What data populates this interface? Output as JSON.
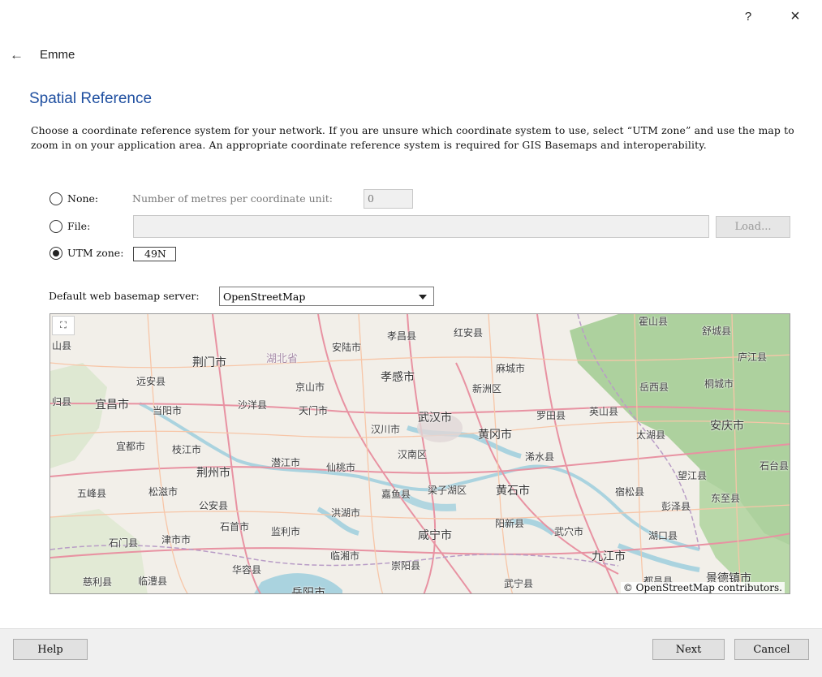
{
  "window": {
    "help_glyph": "?",
    "close_glyph": "×"
  },
  "nav": {
    "back_glyph": "←",
    "title": "Emme"
  },
  "page": {
    "heading": "Spatial Reference",
    "description": "Choose a coordinate reference system for your network. If you are unsure which coordinate system to use, select “UTM zone” and use the map to zoom in on your application area. An appropriate coordinate reference system is required for GIS Basemaps and interoperability."
  },
  "options": {
    "none_label": "None:",
    "none_hint": "Number of metres per coordinate unit:",
    "none_value": "0",
    "file_label": "File:",
    "file_value": "",
    "load_label": "Load...",
    "utm_label": "UTM zone:",
    "utm_value": "49N",
    "selected": "utm"
  },
  "basemap": {
    "label": "Default web basemap server:",
    "selected": "OpenStreetMap"
  },
  "map": {
    "fullscreen_glyph": "⛶",
    "attribution": "© OpenStreetMap contributors.",
    "cities": [
      {
        "name": "山县",
        "cls": "med"
      },
      {
        "name": "荆门市",
        "cls": "big"
      },
      {
        "name": "湖北省",
        "cls": "prov"
      },
      {
        "name": "安陆市",
        "cls": "med"
      },
      {
        "name": "孝昌县",
        "cls": "med"
      },
      {
        "name": "红安县",
        "cls": "med"
      },
      {
        "name": "霍山县",
        "cls": "med"
      },
      {
        "name": "舒城县",
        "cls": "med"
      },
      {
        "name": "庐江县",
        "cls": "med"
      },
      {
        "name": "远安县",
        "cls": "med"
      },
      {
        "name": "京山市",
        "cls": "med"
      },
      {
        "name": "孝感市",
        "cls": "big"
      },
      {
        "name": "麻城市",
        "cls": "med"
      },
      {
        "name": "新洲区",
        "cls": "med"
      },
      {
        "name": "岳西县",
        "cls": "med"
      },
      {
        "name": "桐城市",
        "cls": "med"
      },
      {
        "name": "归县",
        "cls": "med"
      },
      {
        "name": "宜昌市",
        "cls": "big"
      },
      {
        "name": "当阳市",
        "cls": "med"
      },
      {
        "name": "沙洋县",
        "cls": "med"
      },
      {
        "name": "天门市",
        "cls": "med"
      },
      {
        "name": "汉川市",
        "cls": "med"
      },
      {
        "name": "武汉市",
        "cls": "big"
      },
      {
        "name": "罗田县",
        "cls": "med"
      },
      {
        "name": "英山县",
        "cls": "med"
      },
      {
        "name": "宜都市",
        "cls": "med"
      },
      {
        "name": "枝江市",
        "cls": "med"
      },
      {
        "name": "黄冈市",
        "cls": "big"
      },
      {
        "name": "太湖县",
        "cls": "med"
      },
      {
        "name": "安庆市",
        "cls": "big"
      },
      {
        "name": "汉南区",
        "cls": "med"
      },
      {
        "name": "浠水县",
        "cls": "med"
      },
      {
        "name": "荆州市",
        "cls": "big"
      },
      {
        "name": "潜江市",
        "cls": "med"
      },
      {
        "name": "仙桃市",
        "cls": "med"
      },
      {
        "name": "望江县",
        "cls": "med"
      },
      {
        "name": "石台县",
        "cls": "med"
      },
      {
        "name": "五峰县",
        "cls": "med"
      },
      {
        "name": "松滋市",
        "cls": "med"
      },
      {
        "name": "嘉鱼县",
        "cls": "med"
      },
      {
        "name": "梁子湖区",
        "cls": "med"
      },
      {
        "name": "黄石市",
        "cls": "big"
      },
      {
        "name": "宿松县",
        "cls": "med"
      },
      {
        "name": "东至县",
        "cls": "med"
      },
      {
        "name": "公安县",
        "cls": "med"
      },
      {
        "name": "彭泽县",
        "cls": "med"
      },
      {
        "name": "洪湖市",
        "cls": "med"
      },
      {
        "name": "石首市",
        "cls": "med"
      },
      {
        "name": "监利市",
        "cls": "med"
      },
      {
        "name": "阳新县",
        "cls": "med"
      },
      {
        "name": "武穴市",
        "cls": "med"
      },
      {
        "name": "石门县",
        "cls": "med"
      },
      {
        "name": "津市市",
        "cls": "med"
      },
      {
        "name": "咸宁市",
        "cls": "big"
      },
      {
        "name": "湖口县",
        "cls": "med"
      },
      {
        "name": "九江市",
        "cls": "big"
      },
      {
        "name": "临湘市",
        "cls": "med"
      },
      {
        "name": "崇阳县",
        "cls": "med"
      },
      {
        "name": "华容县",
        "cls": "med"
      },
      {
        "name": "慈利县",
        "cls": "med"
      },
      {
        "name": "临澧县",
        "cls": "med"
      },
      {
        "name": "岳阳市",
        "cls": "big"
      },
      {
        "name": "武宁县",
        "cls": "med"
      },
      {
        "name": "都昌县",
        "cls": "med"
      },
      {
        "name": "景德镇市",
        "cls": "big"
      }
    ]
  },
  "footer": {
    "help_label": "Help",
    "next_label": "Next",
    "cancel_label": "Cancel"
  },
  "colors": {
    "heading": "#1f4fa0",
    "map_land": "#f2efe9",
    "map_forest": "#add19e",
    "map_water": "#aad3df",
    "map_road_major": "#e892a2",
    "map_road_minor": "#f7c6a8"
  }
}
